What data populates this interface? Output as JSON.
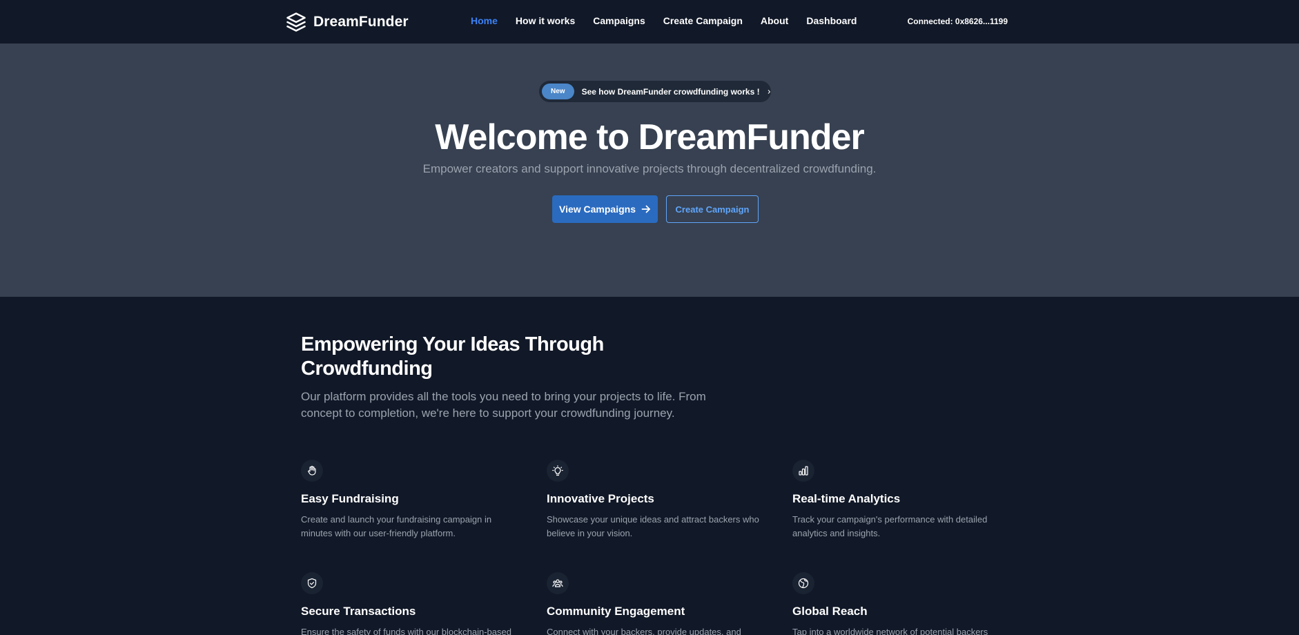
{
  "nav": {
    "logo_text": "DreamFunder",
    "links": [
      "Home",
      "How it works",
      "Campaigns",
      "Create Campaign",
      "About",
      "Dashboard"
    ],
    "active_link": "Home",
    "wallet": "Connected: 0x8626...1199"
  },
  "hero": {
    "badge": "New",
    "announcement": "See how DreamFunder crowdfunding works !",
    "title": "Welcome to DreamFunder",
    "subtitle": "Empower creators and support innovative projects through decentralized crowdfunding.",
    "primary_button": "View Campaigns",
    "secondary_button": "Create Campaign"
  },
  "features": {
    "title": "Empowering Your Ideas Through Crowdfunding",
    "subtitle": "Our platform provides all the tools you need to bring your projects to life. From concept to completion, we're here to support your crowdfunding journey.",
    "items": [
      {
        "icon": "hand-icon",
        "title": "Easy Fundraising",
        "desc": "Create and launch your fundraising campaign in minutes with our user-friendly platform."
      },
      {
        "icon": "lightbulb-icon",
        "title": "Innovative Projects",
        "desc": "Showcase your unique ideas and attract backers who believe in your vision."
      },
      {
        "icon": "bar-chart-icon",
        "title": "Real-time Analytics",
        "desc": "Track your campaign's performance with detailed analytics and insights."
      },
      {
        "icon": "shield-check-icon",
        "title": "Secure Transactions",
        "desc": "Ensure the safety of funds with our blockchain-based"
      },
      {
        "icon": "users-icon",
        "title": "Community Engagement",
        "desc": "Connect with your backers, provide updates, and"
      },
      {
        "icon": "globe-icon",
        "title": "Global Reach",
        "desc": "Tap into a worldwide network of potential backers"
      }
    ]
  },
  "colors": {
    "nav_bg": "#111827",
    "hero_bg": "#374151",
    "accent": "#3b82f6",
    "primary_button": "#2a6bc0",
    "muted_text": "#9ca3af"
  }
}
